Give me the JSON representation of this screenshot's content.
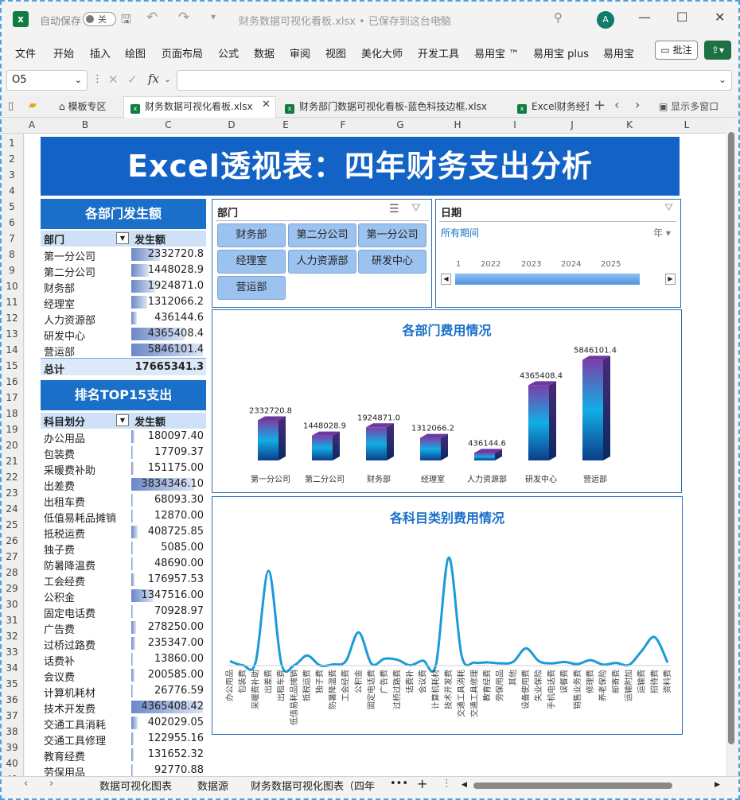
{
  "app": {
    "autosave_label": "自动保存",
    "autosave_state": "关",
    "doc_title": "财务数据可视化看板.xlsx • 已保存到这台电脑",
    "user_initial": "A"
  },
  "menu": {
    "items": [
      "文件",
      "开始",
      "插入",
      "绘图",
      "页面布局",
      "公式",
      "数据",
      "审阅",
      "视图",
      "美化大师",
      "开发工具",
      "易用宝 ™",
      "易用宝 plus",
      "易用宝"
    ],
    "comment_label": "批注"
  },
  "formula": {
    "name_box": "O5",
    "fx_label": "fx",
    "content": ""
  },
  "doc_tabs": {
    "tabs": [
      "模板专区",
      "财务数据可视化看板.xlsx",
      "财务部门数据可视化看板-蓝色科技边框.xlsx",
      "Excel财务经营"
    ],
    "show_multi": "显示多窗口"
  },
  "columns": [
    "A",
    "B",
    "C",
    "D",
    "E",
    "F",
    "G",
    "H",
    "I",
    "J",
    "K",
    "L"
  ],
  "rows": [
    "1",
    "2",
    "3",
    "4",
    "5",
    "6",
    "7",
    "8",
    "9",
    "10",
    "11",
    "12",
    "13",
    "14",
    "15",
    "16",
    "17",
    "18",
    "19",
    "20",
    "21",
    "22",
    "23",
    "24",
    "25",
    "26",
    "27",
    "28",
    "29",
    "30",
    "31",
    "32",
    "33",
    "34",
    "35",
    "36",
    "37",
    "38",
    "39",
    "40",
    "41"
  ],
  "dashboard": {
    "title": "Excel透视表：四年财务支出分析",
    "dept_section": {
      "heading": "各部门发生额",
      "col_label": "部门",
      "col_value": "发生额",
      "rows": [
        {
          "label": "第一分公司",
          "value": "2332720.8",
          "ratio": 0.399
        },
        {
          "label": "第二分公司",
          "value": "1448028.9",
          "ratio": 0.248
        },
        {
          "label": "财务部",
          "value": "1924871.0",
          "ratio": 0.329
        },
        {
          "label": "经理室",
          "value": "1312066.2",
          "ratio": 0.224
        },
        {
          "label": "人力资源部",
          "value": "436144.6",
          "ratio": 0.075
        },
        {
          "label": "研发中心",
          "value": "4365408.4",
          "ratio": 0.747
        },
        {
          "label": "营运部",
          "value": "5846101.4",
          "ratio": 1.0
        }
      ],
      "total_label": "总计",
      "total_value": "17665341.3"
    },
    "top_section": {
      "heading": "排名TOP15支出",
      "col_label": "科目划分",
      "col_value": "发生额",
      "rows": [
        {
          "label": "办公用品",
          "value": "180097.40",
          "ratio": 0.041
        },
        {
          "label": "包装费",
          "value": "17709.37",
          "ratio": 0.004
        },
        {
          "label": "采暖费补助",
          "value": "151175.00",
          "ratio": 0.035
        },
        {
          "label": "出差费",
          "value": "3834346.10",
          "ratio": 0.878
        },
        {
          "label": "出租车费",
          "value": "68093.30",
          "ratio": 0.016
        },
        {
          "label": "低值易耗品摊销",
          "value": "12870.00",
          "ratio": 0.003
        },
        {
          "label": "抵税运费",
          "value": "408725.85",
          "ratio": 0.094
        },
        {
          "label": "独子费",
          "value": "5085.00",
          "ratio": 0.001
        },
        {
          "label": "防暑降温费",
          "value": "48690.00",
          "ratio": 0.011
        },
        {
          "label": "工会经费",
          "value": "176957.53",
          "ratio": 0.041
        },
        {
          "label": "公积金",
          "value": "1347516.00",
          "ratio": 0.309
        },
        {
          "label": "固定电话费",
          "value": "70928.97",
          "ratio": 0.016
        },
        {
          "label": "广告费",
          "value": "278250.00",
          "ratio": 0.064
        },
        {
          "label": "过桥过路费",
          "value": "235347.00",
          "ratio": 0.054
        },
        {
          "label": "话费补",
          "value": "13860.00",
          "ratio": 0.003
        },
        {
          "label": "会议费",
          "value": "200585.00",
          "ratio": 0.046
        },
        {
          "label": "计算机耗材",
          "value": "26776.59",
          "ratio": 0.006
        },
        {
          "label": "技术开发费",
          "value": "4365408.42",
          "ratio": 1.0
        },
        {
          "label": "交通工具消耗",
          "value": "402029.05",
          "ratio": 0.092
        },
        {
          "label": "交通工具修理",
          "value": "122955.16",
          "ratio": 0.028
        },
        {
          "label": "教育经费",
          "value": "131652.32",
          "ratio": 0.03
        },
        {
          "label": "劳保用品",
          "value": "92770.88",
          "ratio": 0.021
        }
      ]
    },
    "dept_slicer": {
      "title": "部门",
      "buttons": [
        "财务部",
        "第二分公司",
        "第一分公司",
        "经理室",
        "人力资源部",
        "研发中心",
        "营运部"
      ]
    },
    "date_slicer": {
      "title": "日期",
      "period_label": "所有期间",
      "level_label": "年",
      "ticks": [
        "1",
        "2022",
        "2023",
        "2024",
        "2025"
      ]
    }
  },
  "chart_data": [
    {
      "type": "bar",
      "title": "各部门费用情况",
      "categories": [
        "第一分公司",
        "第二分公司",
        "财务部",
        "经理室",
        "人力资源部",
        "研发中心",
        "营运部"
      ],
      "values": [
        2332720.8,
        1448028.9,
        1924871.0,
        1312066.2,
        436144.6,
        4365408.4,
        5846101.4
      ],
      "data_labels": [
        "2332720.8",
        "1448028.9",
        "1924871.0",
        "1312066.2",
        "436144.6",
        "4365408.4",
        "5846101.4"
      ],
      "ylim": [
        0,
        6000000
      ],
      "grid": false,
      "legend": "none"
    },
    {
      "type": "line",
      "title": "各科目类别费用情况",
      "categories": [
        "办公用品",
        "包装费",
        "采暖费补助",
        "出差费",
        "出租车费",
        "低值易耗品摊销",
        "抵税运费",
        "独子费",
        "防暑降温费",
        "工会经费",
        "公积金",
        "固定电话费",
        "广告费",
        "过桥过路费",
        "话费补",
        "会议费",
        "计算机耗材",
        "技术开发费",
        "交通工具消耗",
        "交通工具修理",
        "教育经费",
        "劳保用品",
        "其他",
        "设备使用费",
        "失业保险",
        "手机电话费",
        "误餐费",
        "销售业务费",
        "修理费",
        "养老保险",
        "邮寄费",
        "运输附加",
        "运输费",
        "招待费",
        "资料费"
      ],
      "values": [
        180097.4,
        17709.37,
        151175.0,
        3834346.1,
        68093.3,
        12870.0,
        408725.85,
        5085.0,
        48690.0,
        176957.53,
        1347516.0,
        70928.97,
        278250.0,
        235347.0,
        13860.0,
        200585.0,
        26776.59,
        4365408.42,
        402029.05,
        122955.16,
        131652.32,
        92770.88,
        150000,
        700000,
        180000,
        90000,
        150000,
        60000,
        220000,
        40000,
        110000,
        30000,
        600000,
        1150000,
        120000
      ],
      "ylim": [
        0,
        4500000
      ],
      "grid": false,
      "legend": "none"
    }
  ],
  "sheet_tabs": {
    "tabs": [
      "数据可视化图表",
      "数据源",
      "财务数据可视化图表（四年"
    ],
    "more": "•••",
    "add": "+"
  },
  "colors": {
    "banner": "#1363c6",
    "section_header": "#1a6fc8",
    "slicer_button": "#9cc3f0",
    "chart_title": "#1a6fc8",
    "bar_top": "#7b3fa8",
    "bar_mid": "#12aee6",
    "bar_bottom": "#0c3d8a"
  }
}
